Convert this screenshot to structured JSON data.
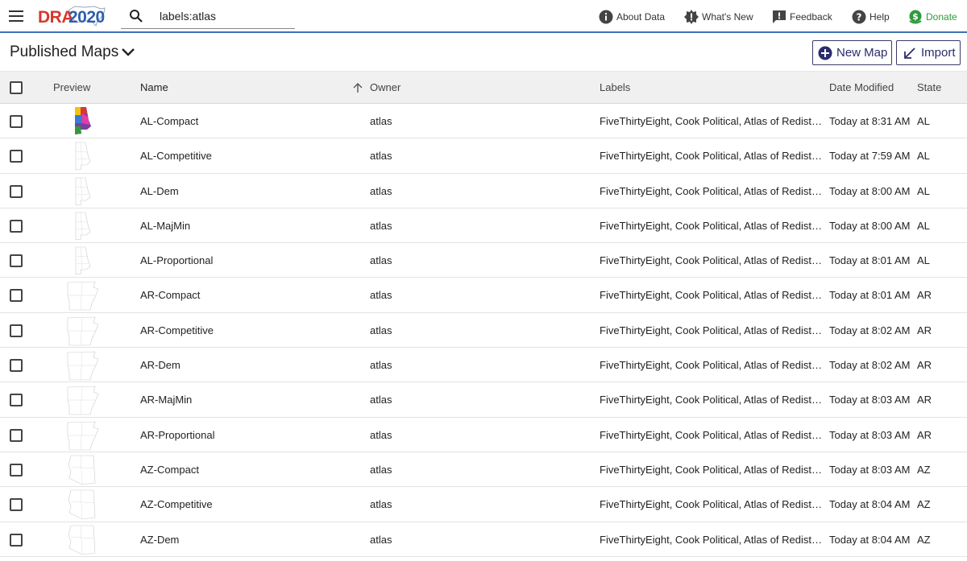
{
  "app": {
    "logo_left": "DRA",
    "logo_right": "2020"
  },
  "search": {
    "value": "labels:atlas"
  },
  "nav": {
    "about": "About Data",
    "whats_new": "What's New",
    "feedback": "Feedback",
    "help": "Help",
    "donate": "Donate"
  },
  "page": {
    "title": "Published Maps",
    "new_map": "New Map",
    "import": "Import"
  },
  "table": {
    "headers": {
      "preview": "Preview",
      "name": "Name",
      "owner": "Owner",
      "labels": "Labels",
      "date": "Date Modified",
      "state": "State"
    },
    "rows": [
      {
        "name": "AL-Compact",
        "owner": "atlas",
        "labels": "FiveThirtyEight, Cook Political, Atlas of Redistricting",
        "date": "Today at 8:31 AM",
        "state": "AL",
        "thumb": "al-color"
      },
      {
        "name": "AL-Competitive",
        "owner": "atlas",
        "labels": "FiveThirtyEight, Cook Political, Atlas of Redistricting",
        "date": "Today at 7:59 AM",
        "state": "AL",
        "thumb": "al"
      },
      {
        "name": "AL-Dem",
        "owner": "atlas",
        "labels": "FiveThirtyEight, Cook Political, Atlas of Redistricting",
        "date": "Today at 8:00 AM",
        "state": "AL",
        "thumb": "al"
      },
      {
        "name": "AL-MajMin",
        "owner": "atlas",
        "labels": "FiveThirtyEight, Cook Political, Atlas of Redistricting",
        "date": "Today at 8:00 AM",
        "state": "AL",
        "thumb": "al"
      },
      {
        "name": "AL-Proportional",
        "owner": "atlas",
        "labels": "FiveThirtyEight, Cook Political, Atlas of Redistricting",
        "date": "Today at 8:01 AM",
        "state": "AL",
        "thumb": "al"
      },
      {
        "name": "AR-Compact",
        "owner": "atlas",
        "labels": "FiveThirtyEight, Cook Political, Atlas of Redistricting",
        "date": "Today at 8:01 AM",
        "state": "AR",
        "thumb": "ar"
      },
      {
        "name": "AR-Competitive",
        "owner": "atlas",
        "labels": "FiveThirtyEight, Cook Political, Atlas of Redistricting",
        "date": "Today at 8:02 AM",
        "state": "AR",
        "thumb": "ar"
      },
      {
        "name": "AR-Dem",
        "owner": "atlas",
        "labels": "FiveThirtyEight, Cook Political, Atlas of Redistricting",
        "date": "Today at 8:02 AM",
        "state": "AR",
        "thumb": "ar"
      },
      {
        "name": "AR-MajMin",
        "owner": "atlas",
        "labels": "FiveThirtyEight, Cook Political, Atlas of Redistricting",
        "date": "Today at 8:03 AM",
        "state": "AR",
        "thumb": "ar"
      },
      {
        "name": "AR-Proportional",
        "owner": "atlas",
        "labels": "FiveThirtyEight, Cook Political, Atlas of Redistricting",
        "date": "Today at 8:03 AM",
        "state": "AR",
        "thumb": "ar"
      },
      {
        "name": "AZ-Compact",
        "owner": "atlas",
        "labels": "FiveThirtyEight, Cook Political, Atlas of Redistricting",
        "date": "Today at 8:03 AM",
        "state": "AZ",
        "thumb": "az"
      },
      {
        "name": "AZ-Competitive",
        "owner": "atlas",
        "labels": "FiveThirtyEight, Cook Political, Atlas of Redistricting",
        "date": "Today at 8:04 AM",
        "state": "AZ",
        "thumb": "az"
      },
      {
        "name": "AZ-Dem",
        "owner": "atlas",
        "labels": "FiveThirtyEight, Cook Political, Atlas of Redistricting",
        "date": "Today at 8:04 AM",
        "state": "AZ",
        "thumb": "az"
      }
    ]
  },
  "colors": {
    "accent": "#3f6fb5",
    "brand_red": "#d6372c",
    "brand_blue": "#2f5fae",
    "donate": "#2e9b3b",
    "button": "#2b2b6e"
  }
}
